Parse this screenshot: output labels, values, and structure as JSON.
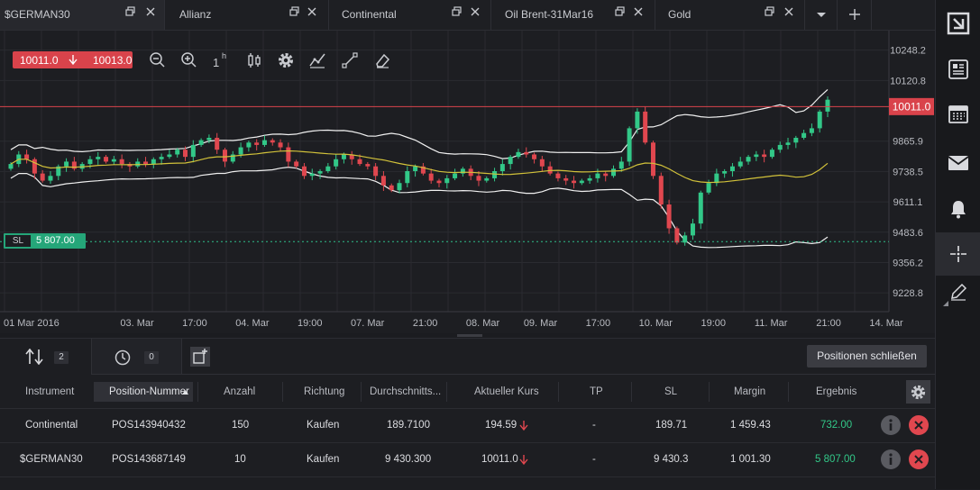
{
  "tabs": [
    {
      "label": "$GERMAN30",
      "active": true
    },
    {
      "label": "Allianz",
      "active": false
    },
    {
      "label": "Continental",
      "active": false
    },
    {
      "label": "Oil Brent-31Mar16",
      "active": false
    },
    {
      "label": "Gold",
      "active": false
    }
  ],
  "quote": {
    "bid": "10011.0",
    "ask": "10013.0"
  },
  "toolbar": {
    "timeframe": "1",
    "timeframe_unit": "h"
  },
  "sl_marker": {
    "label": "SL",
    "value": "5 807.00"
  },
  "chart_data": {
    "type": "candlestick",
    "y_ticks": [
      "10248.2",
      "10120.8",
      "9865.9",
      "9738.5",
      "9611.1",
      "9483.6",
      "9356.2",
      "9228.8"
    ],
    "x_ticks": [
      "01 Mar 2016",
      "03. Mar",
      "17:00",
      "04. Mar",
      "19:00",
      "07. Mar",
      "21:00",
      "08. Mar",
      "09. Mar",
      "17:00",
      "10. Mar",
      "19:00",
      "11. Mar",
      "21:00",
      "14. Mar"
    ],
    "ylim": [
      9150,
      10330
    ],
    "current_price": "10011.0",
    "current_price_value": 10011,
    "sl_level": 9444,
    "colors": {
      "up": "#32c888",
      "down": "#e0474f",
      "ma": "#d2c23a",
      "bands": "#f0f0f0",
      "price_line": "#d9434b"
    },
    "closes": [
      9770,
      9810,
      9790,
      9730,
      9700,
      9720,
      9760,
      9780,
      9750,
      9770,
      9790,
      9800,
      9780,
      9790,
      9770,
      9760,
      9780,
      9770,
      9790,
      9800,
      9810,
      9830,
      9800,
      9850,
      9870,
      9880,
      9830,
      9780,
      9810,
      9840,
      9860,
      9850,
      9870,
      9860,
      9840,
      9780,
      9760,
      9720,
      9730,
      9740,
      9760,
      9790,
      9810,
      9790,
      9770,
      9760,
      9720,
      9680,
      9660,
      9690,
      9740,
      9760,
      9730,
      9700,
      9690,
      9710,
      9730,
      9750,
      9720,
      9700,
      9710,
      9740,
      9770,
      9800,
      9820,
      9810,
      9790,
      9760,
      9730,
      9710,
      9700,
      9690,
      9700,
      9710,
      9730,
      9720,
      9750,
      9780,
      9920,
      9990,
      9860,
      9720,
      9600,
      9500,
      9440,
      9470,
      9520,
      9650,
      9690,
      9730,
      9740,
      9760,
      9780,
      9800,
      9810,
      9800,
      9830,
      9850,
      9860,
      9880,
      9900,
      9920,
      9990,
      10040
    ]
  },
  "panel": {
    "positions_count": "2",
    "orders_count": "0",
    "close_all_label": "Positionen schließen",
    "columns": [
      "Instrument",
      "Position-Nummer",
      "Anzahl",
      "Richtung",
      "Durchschnitts...",
      "Aktueller Kurs",
      "TP",
      "SL",
      "Margin",
      "Ergebnis"
    ],
    "rows": [
      {
        "instrument": "Continental",
        "position": "POS143940432",
        "quantity": "150",
        "direction": "Kaufen",
        "avg": "189.7100",
        "current": "194.59",
        "tp": "-",
        "sl": "189.71",
        "margin": "1 459.43",
        "result": "732.00"
      },
      {
        "instrument": "$GERMAN30",
        "position": "POS143687149",
        "quantity": "10",
        "direction": "Kaufen",
        "avg": "9 430.300",
        "current": "10011.0",
        "tp": "-",
        "sl": "9 430.3",
        "margin": "1 001.30",
        "result": "5 807.00"
      }
    ]
  }
}
